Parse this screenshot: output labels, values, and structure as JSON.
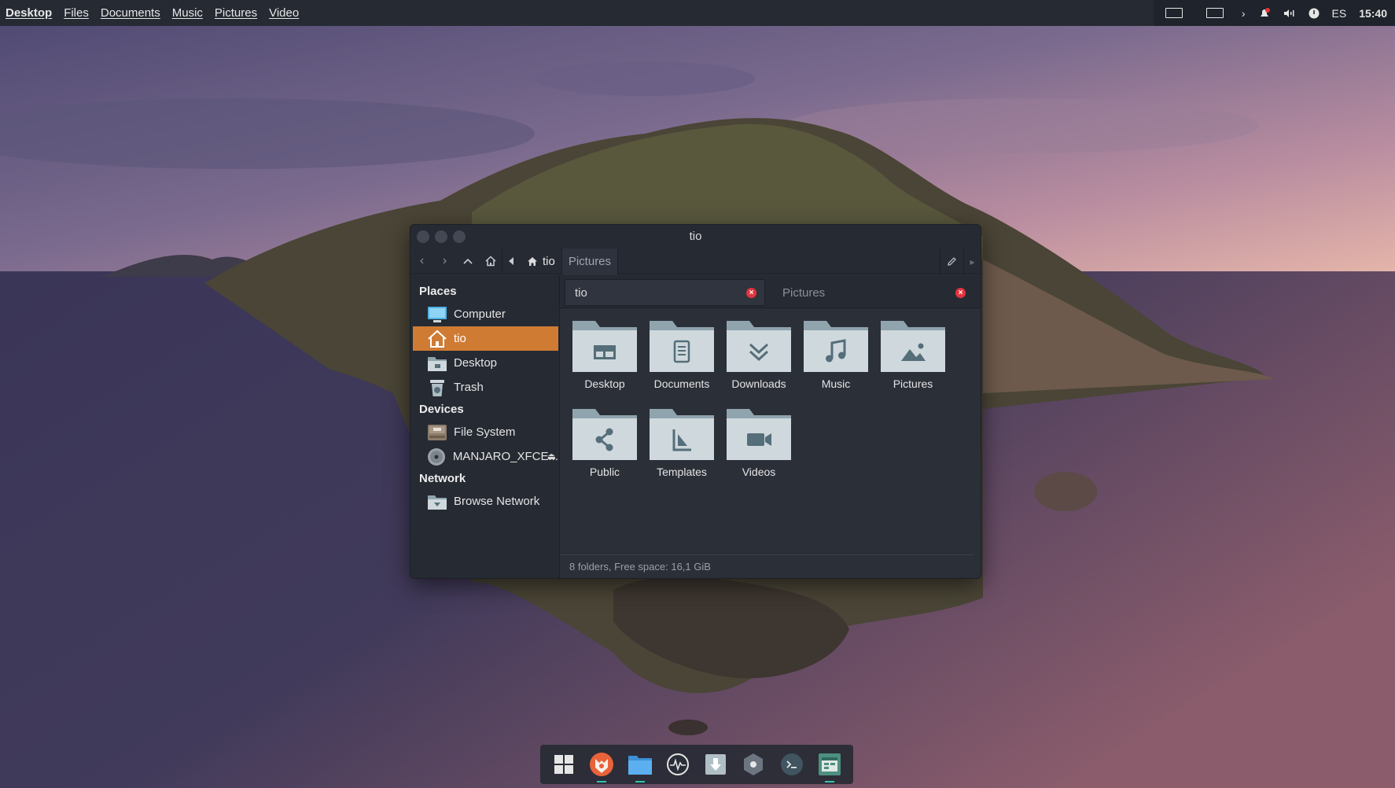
{
  "top_panel": {
    "menu": [
      "Desktop",
      "Files",
      "Documents",
      "Music",
      "Pictures",
      "Video"
    ],
    "tray": {
      "language": "ES",
      "clock": "15:40"
    }
  },
  "window": {
    "title": "tio",
    "breadcrumbs": {
      "current": "tio",
      "next": "Pictures"
    },
    "tabs": [
      {
        "label": "tio",
        "active": true
      },
      {
        "label": "Pictures",
        "active": false
      }
    ],
    "sidebar": {
      "places_heading": "Places",
      "places": [
        {
          "label": "Computer",
          "icon": "computer-icon"
        },
        {
          "label": "tio",
          "icon": "home-icon",
          "selected": true
        },
        {
          "label": "Desktop",
          "icon": "desktop-folder-icon"
        },
        {
          "label": "Trash",
          "icon": "trash-icon"
        }
      ],
      "devices_heading": "Devices",
      "devices": [
        {
          "label": "File System",
          "icon": "hard-drive-icon"
        },
        {
          "label": "MANJARO_XFCE...",
          "icon": "optical-disc-icon"
        }
      ],
      "network_heading": "Network",
      "network": [
        {
          "label": "Browse Network",
          "icon": "network-folder-icon"
        }
      ]
    },
    "folders": [
      {
        "label": "Desktop",
        "icon": "desktop-icon"
      },
      {
        "label": "Documents",
        "icon": "document-icon"
      },
      {
        "label": "Downloads",
        "icon": "download-icon"
      },
      {
        "label": "Music",
        "icon": "music-note-icon"
      },
      {
        "label": "Pictures",
        "icon": "picture-icon"
      },
      {
        "label": "Public",
        "icon": "share-icon"
      },
      {
        "label": "Templates",
        "icon": "template-icon"
      },
      {
        "label": "Videos",
        "icon": "video-camera-icon"
      }
    ],
    "status": "8 folders, Free space: 16,1 GiB"
  },
  "dock": [
    "app-grid-icon",
    "firefox-icon",
    "file-manager-icon",
    "system-monitor-icon",
    "download-manager-icon",
    "settings-icon",
    "terminal-icon",
    "sheets-icon"
  ],
  "colors": {
    "accent": "#cf7b33",
    "folder": "#cfd8dc",
    "folder_tab": "#90a4ae",
    "close": "#e3343d",
    "panel": "#262a33"
  }
}
